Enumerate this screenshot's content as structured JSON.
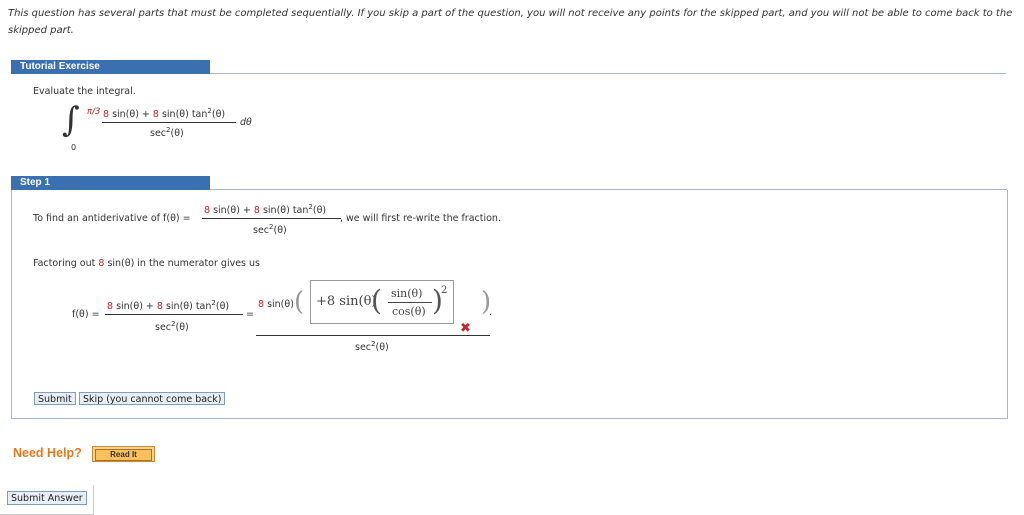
{
  "intro": "This question has several parts that must be completed sequentially. If you skip a part of the question, you will not receive any points for the skipped part, and you will not be able to come back to the skipped part.",
  "tutorial": {
    "header": "Tutorial Exercise",
    "prompt": "Evaluate the integral.",
    "upper_limit": "π/3",
    "lower_limit": "0",
    "numerator_coef1": "8",
    "numerator_mid": " sin(θ) + ",
    "numerator_coef2": "8",
    "numerator_tail": " sin(θ) tan",
    "numerator_exp": "2",
    "numerator_end": "(θ)",
    "denominator": "sec",
    "denominator_exp": "2",
    "denominator_end": "(θ)",
    "dtheta": "dθ"
  },
  "step1": {
    "header": "Step 1",
    "find_text": "To find an antiderivative of f(θ) =",
    "rewrite_text": ", we will first re-write the fraction.",
    "factoring_pre": "Factoring out ",
    "factoring_coef": "8",
    "factoring_post": " sin(θ) in the numerator gives us",
    "f_label": "f(θ) =",
    "equals": "=",
    "rhs_coef": "8",
    "rhs_sin": " sin(θ)",
    "answer_expr": "+8 sin(θ)",
    "answer_frac_num": "sin(θ)",
    "answer_frac_den": "cos(θ)",
    "answer_exp": "2",
    "answer_status": "incorrect",
    "period": ".",
    "submit_label": "Submit",
    "skip_label": "Skip (you cannot come back)"
  },
  "help": {
    "label": "Need Help?",
    "read_it": "Read It"
  },
  "submit_answer": "Submit Answer",
  "colors": {
    "header_blue": "#3a6fb0",
    "red": "#c4262e",
    "help_orange": "#e07a1f"
  }
}
